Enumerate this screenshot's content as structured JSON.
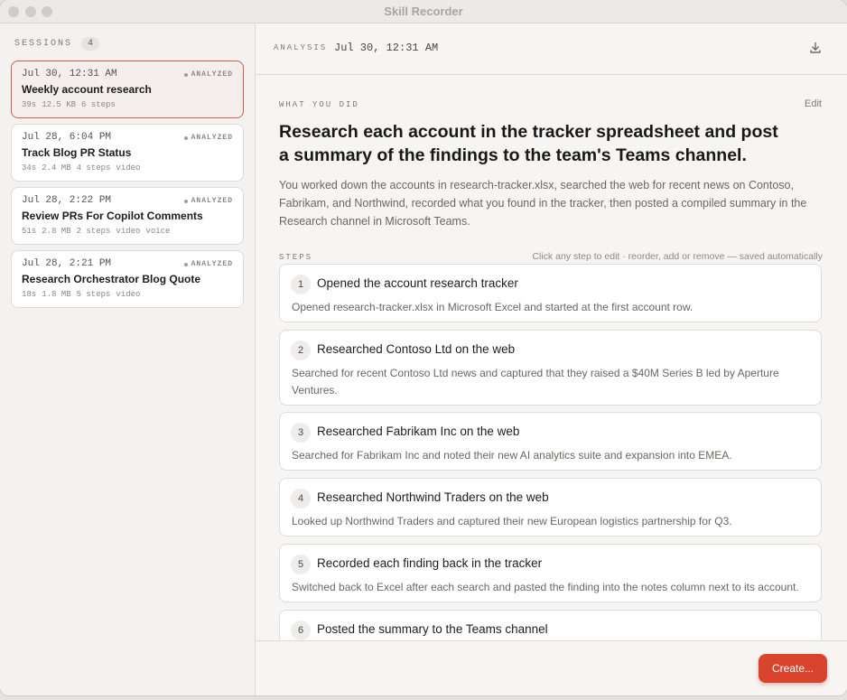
{
  "window": {
    "title": "Skill Recorder"
  },
  "sidebar": {
    "sessions_label": "SESSIONS",
    "sessions_count": "4",
    "sessions": [
      {
        "date": "Jul 30, 12:31 AM",
        "status": "ANALYZED",
        "title": "Weekly account research",
        "meta": [
          "39s",
          "12.5 KB",
          "6 steps"
        ],
        "selected": true
      },
      {
        "date": "Jul 28, 6:04 PM",
        "status": "ANALYZED",
        "title": "Track Blog PR Status",
        "meta": [
          "34s",
          "2.4 MB",
          "4 steps",
          "video"
        ],
        "selected": false
      },
      {
        "date": "Jul 28, 2:22 PM",
        "status": "ANALYZED",
        "title": "Review PRs For Copilot Comments",
        "meta": [
          "51s",
          "2.8 MB",
          "2 steps",
          "video",
          "voice"
        ],
        "selected": false
      },
      {
        "date": "Jul 28, 2:21 PM",
        "status": "ANALYZED",
        "title": "Research Orchestrator Blog Quote",
        "meta": [
          "18s",
          "1.8 MB",
          "5 steps",
          "video"
        ],
        "selected": false
      }
    ]
  },
  "main": {
    "header": {
      "label": "ANALYSIS",
      "date": "Jul 30, 12:31 AM",
      "download_icon": "download-icon"
    },
    "what_you_did_label": "WHAT YOU DID",
    "edit_label": "Edit",
    "summary_title": "Research each account in the tracker spreadsheet and post a summary of the findings to the team's Teams channel.",
    "summary_body": "You worked down the accounts in research-tracker.xlsx, searched the web for recent news on Contoso, Fabrikam, and Northwind, recorded what you found in the tracker, then posted a compiled summary in the Research channel in Microsoft Teams.",
    "steps_label": "STEPS",
    "steps_hint": "Click any step to edit · reorder, add or remove — saved automatically",
    "steps": [
      {
        "num": "1",
        "title": "Opened the account research tracker",
        "desc": "Opened research-tracker.xlsx in Microsoft Excel and started at the first account row."
      },
      {
        "num": "2",
        "title": "Researched Contoso Ltd on the web",
        "desc": "Searched for recent Contoso Ltd news and captured that they raised a $40M Series B led by Aperture Ventures."
      },
      {
        "num": "3",
        "title": "Researched Fabrikam Inc on the web",
        "desc": "Searched for Fabrikam Inc and noted their new AI analytics suite and expansion into EMEA."
      },
      {
        "num": "4",
        "title": "Researched Northwind Traders on the web",
        "desc": "Looked up Northwind Traders and captured their new European logistics partnership for Q3."
      },
      {
        "num": "5",
        "title": "Recorded each finding back in the tracker",
        "desc": "Switched back to Excel after each search and pasted the finding into the notes column next to its account."
      },
      {
        "num": "6",
        "title": "Posted the summary to the Teams channel",
        "desc": ""
      }
    ],
    "create_label": "Create..."
  },
  "colors": {
    "accent": "#d9442f",
    "selected_border": "#d85a48"
  }
}
